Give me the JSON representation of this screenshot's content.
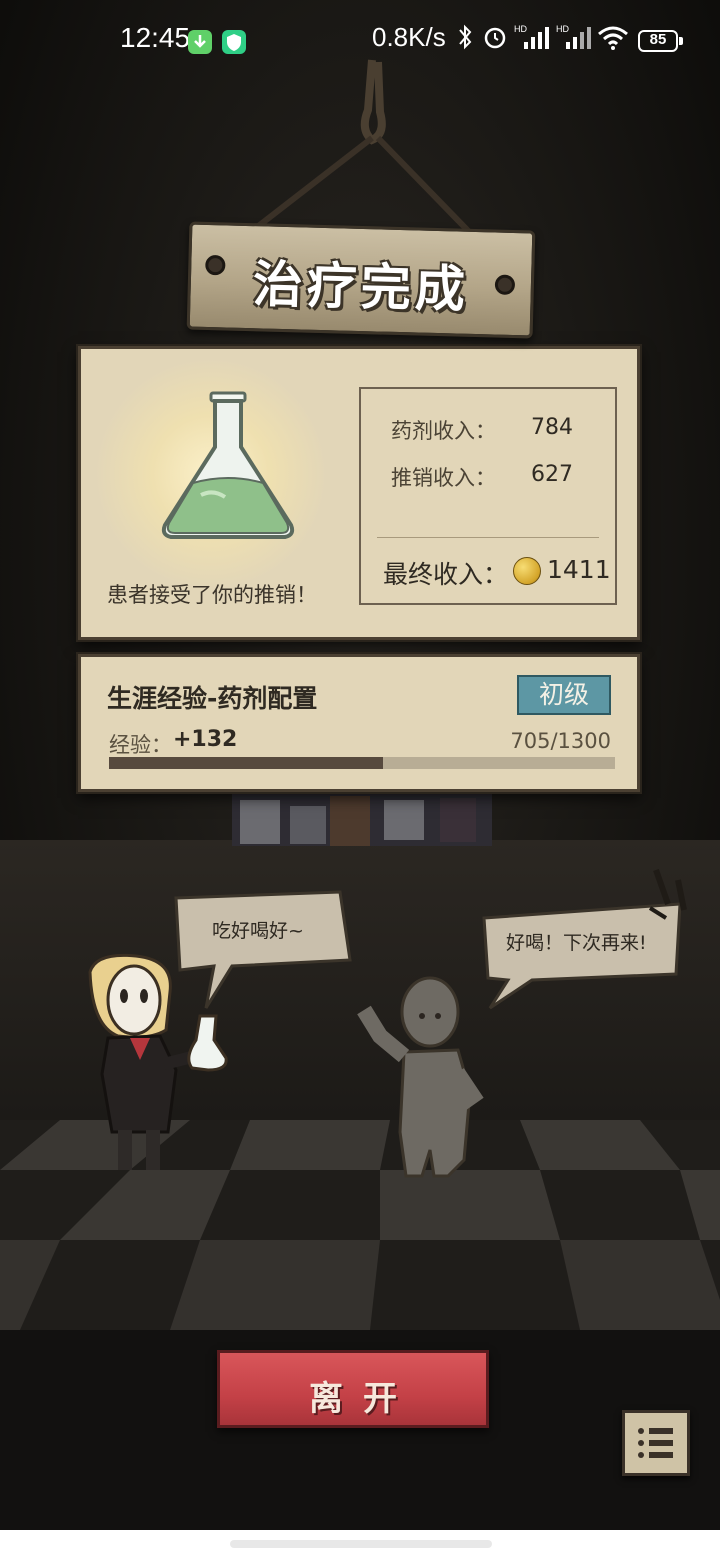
{
  "status_bar": {
    "time": "12:45",
    "network_speed": "0.8K/s",
    "battery": "85",
    "icons": [
      "download-app-icon",
      "shield-app-icon",
      "bluetooth-icon",
      "alarm-icon",
      "hd-signal-icon",
      "hd-signal-icon",
      "wifi-icon",
      "battery-icon"
    ]
  },
  "title_sign": {
    "title": "治疗完成"
  },
  "result_panel": {
    "patient_message": "患者接受了你的推销！",
    "potion_income_label": "药剂收入：",
    "potion_income_value": "784",
    "promo_income_label": "推销收入：",
    "promo_income_value": "627",
    "final_income_label": "最终收入：",
    "final_income_value": "1411",
    "currency_icon": "gold-coin-icon"
  },
  "experience_panel": {
    "title": "生涯经验-药剂配置",
    "rank": "初级",
    "exp_label": "经验：",
    "exp_gain": "+132",
    "exp_progress": "705/1300",
    "exp_current": 705,
    "exp_max": 1300
  },
  "scene": {
    "doctor_speech": "吃好喝好~",
    "patient_speech": "好喝！下次再来!"
  },
  "buttons": {
    "leave": "离开",
    "menu_icon": "list-menu-icon"
  },
  "colors": {
    "parchment": "#e2d6b8",
    "leave_button": "#c44147",
    "rank_badge": "#5d97a4",
    "background": "#141210"
  }
}
